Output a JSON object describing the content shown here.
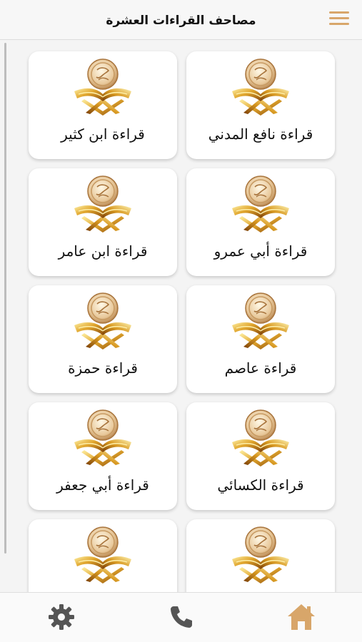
{
  "header": {
    "title": "مصاحف القراءات العشرة",
    "menu_icon": "hamburger-menu-icon",
    "accent_color": "#d8a66a"
  },
  "cards": [
    {
      "label": "قراءة نافع المدني",
      "icon": "quran-book-icon"
    },
    {
      "label": "قراءة ابن كثير",
      "icon": "quran-book-icon"
    },
    {
      "label": "قراءة أبي عمرو",
      "icon": "quran-book-icon"
    },
    {
      "label": "قراءة ابن عامر",
      "icon": "quran-book-icon"
    },
    {
      "label": "قراءة عاصم",
      "icon": "quran-book-icon"
    },
    {
      "label": "قراءة حمزة",
      "icon": "quran-book-icon"
    },
    {
      "label": "قراءة الكسائي",
      "icon": "quran-book-icon"
    },
    {
      "label": "قراءة أبي جعفر",
      "icon": "quran-book-icon"
    },
    {
      "label": "",
      "icon": "quran-book-icon"
    },
    {
      "label": "",
      "icon": "quran-book-icon"
    }
  ],
  "bottom_nav": {
    "items": [
      {
        "name": "settings",
        "icon": "gear-icon",
        "color": "#555555"
      },
      {
        "name": "contact",
        "icon": "phone-icon",
        "color": "#555555"
      },
      {
        "name": "home",
        "icon": "home-icon",
        "color": "#d8a66a",
        "active": true
      }
    ]
  }
}
